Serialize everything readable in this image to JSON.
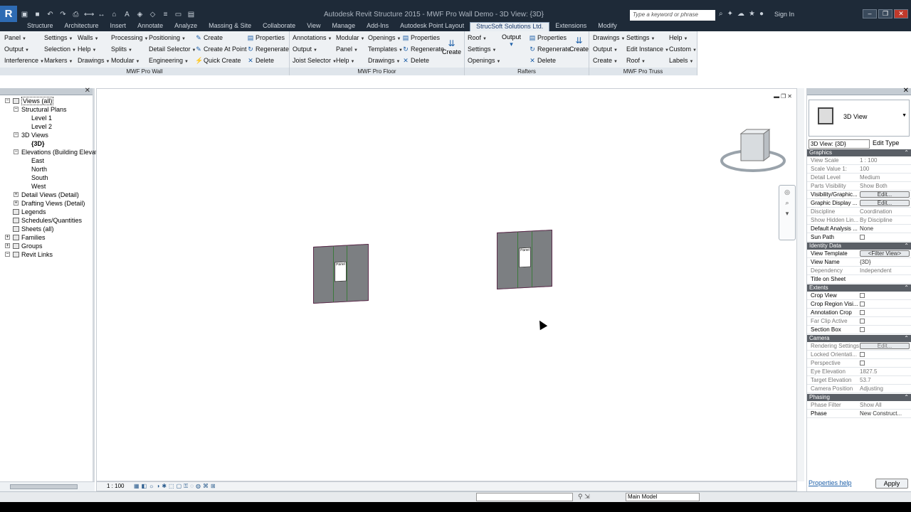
{
  "app": {
    "title": "Autodesk Revit Structure 2015 - MWF Pro Wall Demo - 3D View: {3D}",
    "search_placeholder": "Type a keyword or phrase",
    "sign_in": "Sign In"
  },
  "tabs": [
    "Structure",
    "Architecture",
    "Insert",
    "Annotate",
    "Analyze",
    "Massing & Site",
    "Collaborate",
    "View",
    "Manage",
    "Add-Ins",
    "Autodesk Point Layout",
    "StrucSoft Solutions Ltd.",
    "Extensions",
    "Modify"
  ],
  "ribbon": {
    "wall": {
      "title": "MWF Pro Wall",
      "col1": [
        "Panel",
        "Output",
        "Interference"
      ],
      "col2": [
        "Settings",
        "Selection",
        "Markers"
      ],
      "col3": [
        "Walls",
        "Help",
        "Drawings"
      ],
      "col4": [
        "Processing",
        "Splits",
        "Modular"
      ],
      "col5": [
        "Positioning",
        "Detail Selector",
        "Engineering"
      ],
      "col6": [
        "Create",
        "Create At Point",
        "Quick Create"
      ],
      "col7": [
        "Properties",
        "Regenerate",
        "Delete"
      ]
    },
    "floor": {
      "title": "MWF Pro Floor",
      "col1": [
        "Annotations",
        "Output",
        "Joist Selector"
      ],
      "col2": [
        "Modular",
        "Panel",
        "Help"
      ],
      "col3": [
        "Openings",
        "Templates",
        "Drawings"
      ],
      "col4": [
        "Properties",
        "Regenerate",
        "Delete"
      ],
      "create": "Create"
    },
    "rafters": {
      "title": "Rafters",
      "col1": [
        "Roof",
        "Settings",
        "Openings"
      ],
      "output": "Output",
      "col2": [
        "Properties",
        "Regenerate",
        "Delete"
      ],
      "create": "Create"
    },
    "truss": {
      "title": "MWF Pro Truss",
      "col1": [
        "Drawings",
        "Output",
        "Create"
      ],
      "col2": [
        "Settings",
        "Edit Instance",
        "Roof"
      ],
      "col3": [
        "Help",
        "Custom",
        "Labels"
      ]
    }
  },
  "browser": {
    "items": [
      {
        "label": "Views (all)",
        "level": 0
      },
      {
        "label": "Structural Plans",
        "level": 1
      },
      {
        "label": "Level 1",
        "level": 2
      },
      {
        "label": "Level 2",
        "level": 2
      },
      {
        "label": "3D Views",
        "level": 1
      },
      {
        "label": "{3D}",
        "level": 2
      },
      {
        "label": "Elevations (Building Elevation)",
        "level": 1
      },
      {
        "label": "East",
        "level": 2
      },
      {
        "label": "North",
        "level": 2
      },
      {
        "label": "South",
        "level": 2
      },
      {
        "label": "West",
        "level": 2
      },
      {
        "label": "Detail Views (Detail)",
        "level": 1
      },
      {
        "label": "Drafting Views (Detail)",
        "level": 1
      },
      {
        "label": "Legends",
        "level": 0
      },
      {
        "label": "Schedules/Quantities",
        "level": 0
      },
      {
        "label": "Sheets (all)",
        "level": 0
      },
      {
        "label": "Families",
        "level": 0
      },
      {
        "label": "Groups",
        "level": 0
      },
      {
        "label": "Revit Links",
        "level": 0
      }
    ]
  },
  "canvas": {
    "wall1_label": "Panel",
    "wall2_label": "Panel",
    "scale": "1 : 100"
  },
  "properties": {
    "type_name": "3D View",
    "selector": "3D View: {3D}",
    "edit_type": "Edit Type",
    "groups": [
      {
        "name": "Graphics",
        "rows": [
          {
            "k": "View Scale",
            "v": "1 : 100",
            "dim": true
          },
          {
            "k": "Scale Value    1:",
            "v": "100",
            "dim": true
          },
          {
            "k": "Detail Level",
            "v": "Medium",
            "dim": true
          },
          {
            "k": "Parts Visibility",
            "v": "Show Both",
            "dim": true
          },
          {
            "k": "Visibility/Graphic...",
            "btn": "Edit..."
          },
          {
            "k": "Graphic Display ...",
            "btn": "Edit..."
          },
          {
            "k": "Discipline",
            "v": "Coordination",
            "dim": true
          },
          {
            "k": "Show Hidden Lin...",
            "v": "By Discipline",
            "dim": true
          },
          {
            "k": "Default Analysis ...",
            "v": "None"
          },
          {
            "k": "Sun Path",
            "chk": true
          }
        ]
      },
      {
        "name": "Identity Data",
        "rows": [
          {
            "k": "View Template",
            "btn": "<Filter View>"
          },
          {
            "k": "View Name",
            "v": "{3D}"
          },
          {
            "k": "Dependency",
            "v": "Independent",
            "dim": true
          },
          {
            "k": "Title on Sheet",
            "v": ""
          }
        ]
      },
      {
        "name": "Extents",
        "rows": [
          {
            "k": "Crop View",
            "chk": true
          },
          {
            "k": "Crop Region Visi...",
            "chk": true
          },
          {
            "k": "Annotation Crop",
            "chk": true
          },
          {
            "k": "Far Clip Active",
            "chk": true,
            "dim": true
          },
          {
            "k": "Section Box",
            "chk": true
          }
        ]
      },
      {
        "name": "Camera",
        "rows": [
          {
            "k": "Rendering Settings",
            "btn": "Edit...",
            "dim": true
          },
          {
            "k": "Locked Orientati...",
            "chk": true,
            "dim": true
          },
          {
            "k": "Perspective",
            "chk": true,
            "dim": true
          },
          {
            "k": "Eye Elevation",
            "v": "1827.5",
            "dim": true
          },
          {
            "k": "Target Elevation",
            "v": "53.7",
            "dim": true
          },
          {
            "k": "Camera Position",
            "v": "Adjusting",
            "dim": true
          }
        ]
      },
      {
        "name": "Phasing",
        "rows": [
          {
            "k": "Phase Filter",
            "v": "Show All",
            "dim": true
          },
          {
            "k": "Phase",
            "v": "New Construct..."
          }
        ]
      }
    ],
    "help": "Properties help",
    "apply": "Apply"
  },
  "status": {
    "model": "Main Model"
  }
}
